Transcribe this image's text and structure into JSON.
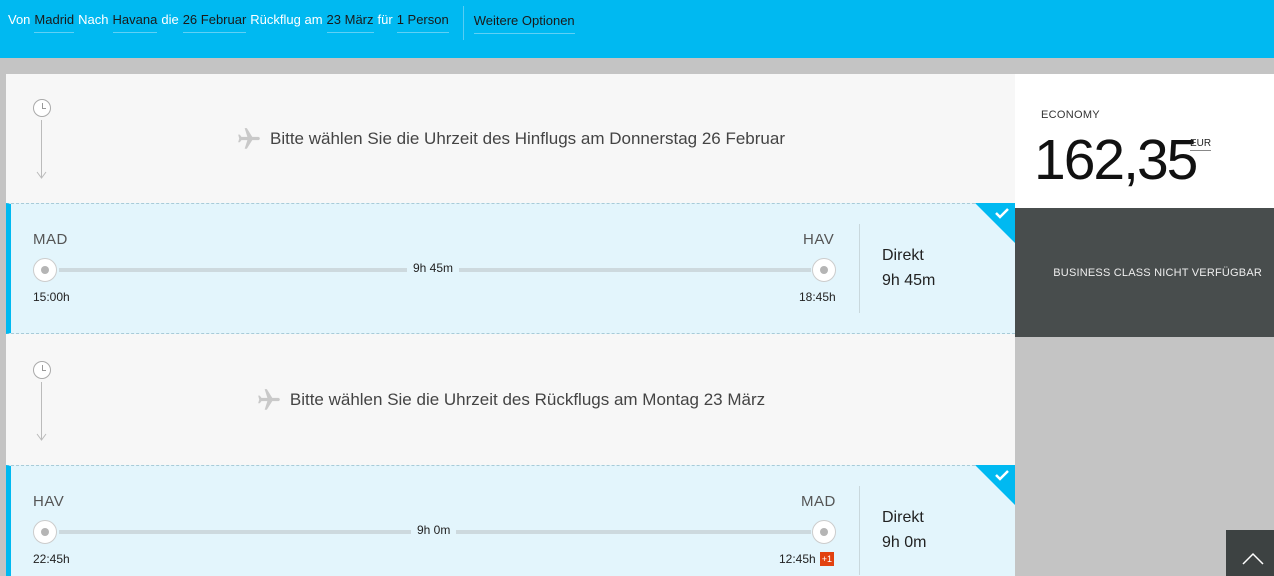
{
  "search": {
    "from_word": "Von",
    "from": "Madrid",
    "to_word": "Nach",
    "to": "Havana",
    "date_word": "die",
    "outbound_date": "26 Februar",
    "return_word": "Rückflug am",
    "return_date": "23 März",
    "pax_word": "für",
    "passengers": "1 Person",
    "more_options": "Weitere Optionen"
  },
  "outbound_header": "Bitte wählen Sie die Uhrzeit des Hinflugs am Donnerstag 26 Februar",
  "return_header": "Bitte wählen Sie die Uhrzeit des Rückflugs am Montag 23 März",
  "flights": [
    {
      "origin": "MAD",
      "destination": "HAV",
      "duration": "9h 45m",
      "depart": "15:00h",
      "arrive": "18:45h",
      "day_offset": "",
      "stops": "Direkt",
      "total": "9h 45m",
      "selected": true
    },
    {
      "origin": "HAV",
      "destination": "MAD",
      "duration": "9h 0m",
      "depart": "22:45h",
      "arrive": "12:45h",
      "day_offset": "+1",
      "stops": "Direkt",
      "total": "9h 0m",
      "selected": true
    }
  ],
  "fare": {
    "class_label": "ECONOMY",
    "price": "162,35",
    "currency": "EUR"
  },
  "business_label": "BUSINESS CLASS NICHT VERFÜGBAR",
  "colors": {
    "brand": "#00b9f1",
    "selected_row": "#e3f5fc",
    "business_bg": "#484d4d",
    "day_offset_badge": "#e2410f"
  },
  "icons": [
    "clock-icon",
    "plane-icon",
    "check-icon",
    "chevron-up-icon"
  ]
}
